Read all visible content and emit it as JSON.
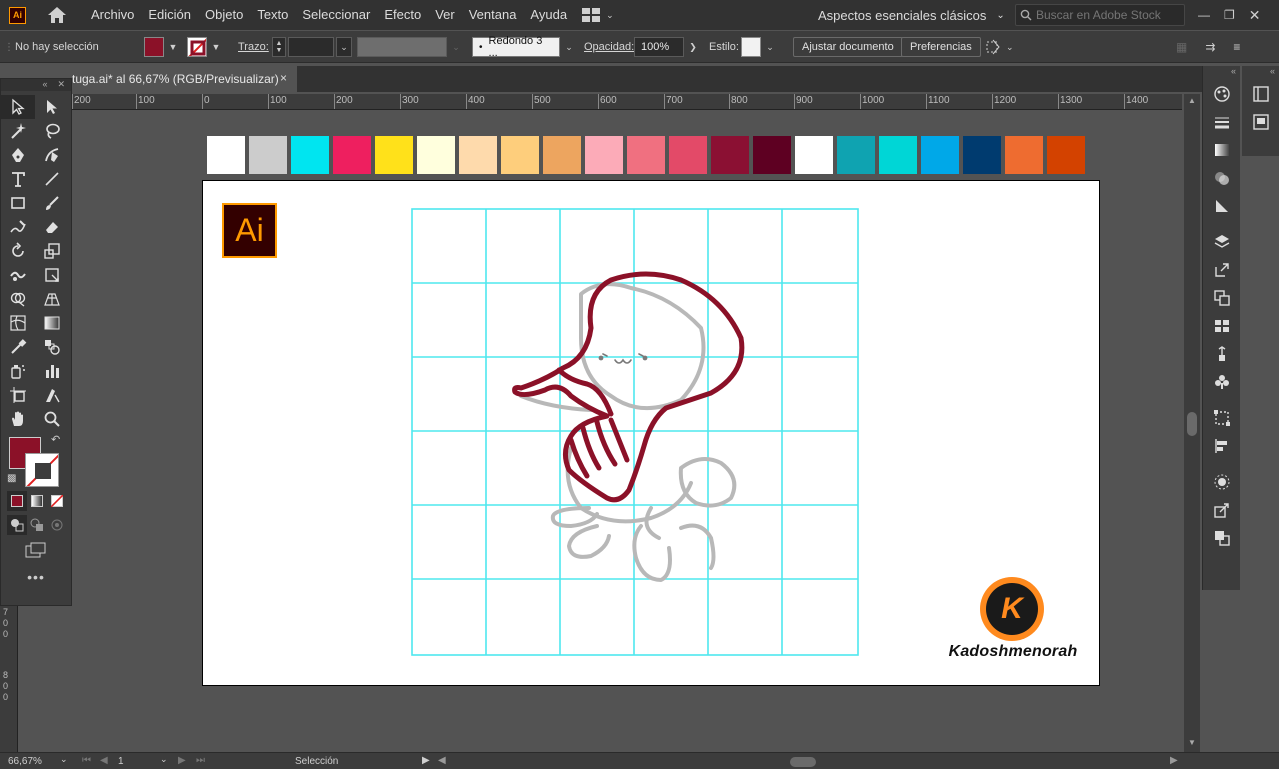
{
  "menubar": {
    "app_logo": "Ai",
    "menus": [
      "Archivo",
      "Edición",
      "Objeto",
      "Texto",
      "Seleccionar",
      "Efecto",
      "Ver",
      "Ventana",
      "Ayuda"
    ],
    "workspace": "Aspectos esenciales clásicos",
    "search_placeholder": "Buscar en Adobe Stock"
  },
  "controlbar": {
    "selection_status": "No hay selección",
    "fill_color": "#8b1128",
    "stroke_label": "Trazo:",
    "brush_label": "Redondo 3 ...",
    "opacity_label": "Opacidad:",
    "opacity_value": "100%",
    "style_label": "Estilo:",
    "fit_document_button": "Ajustar documento",
    "preferences_button": "Preferencias"
  },
  "document": {
    "tab_title": "tuga.ai* al 66,67% (RGB/Previsualizar)",
    "close": "×"
  },
  "ruler": {
    "ticks": [
      "200",
      "100",
      "0",
      "100",
      "200",
      "300",
      "400",
      "500",
      "600",
      "700",
      "800",
      "900",
      "1000",
      "1100",
      "1200",
      "1300",
      "1400"
    ],
    "left_labels": [
      "7",
      "0",
      "0",
      "8",
      "0",
      "0"
    ]
  },
  "palette": [
    "#ffffff",
    "#cccccc",
    "#00e5f0",
    "#ee1f5f",
    "#ffe11a",
    "#ffffdd",
    "#fedaac",
    "#fece7c",
    "#eda55f",
    "#fcabb8",
    "#f07080",
    "#e34a68",
    "#8b1033",
    "#5e0022",
    "#ffffff",
    "#0fa3b1",
    "#00d6d6",
    "#00a8e8",
    "#003b6f",
    "#ee6c30",
    "#d34200"
  ],
  "artboard": {
    "ai_badge": "Ai",
    "brand_letter": "K",
    "brand_name": "Kadoshmenorah"
  },
  "tools": {
    "fill_color": "#8b1128"
  },
  "statusbar": {
    "zoom": "66,67%",
    "artboard_number": "1",
    "tool_status": "Selección"
  }
}
